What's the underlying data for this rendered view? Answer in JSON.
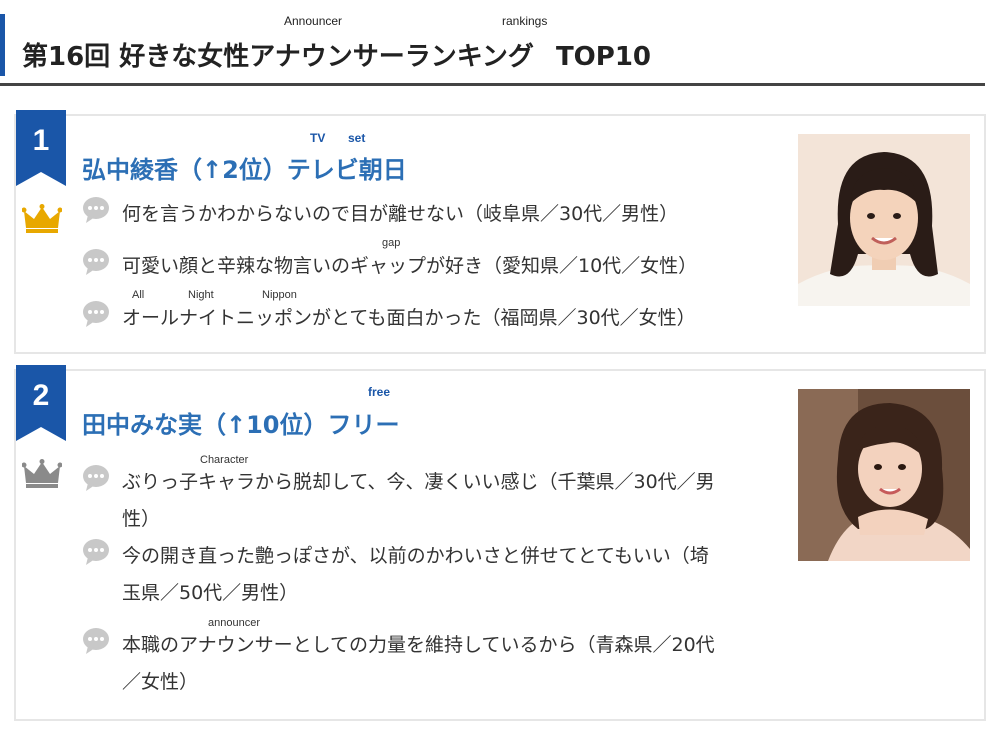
{
  "header": {
    "title_main": "第16回 好きな女性アナウンサーランキング",
    "title_suffix": "TOP10",
    "ruby_announcer": "Announcer",
    "ruby_rankings": "rankings"
  },
  "colors": {
    "accent": "#1a56a8",
    "name_blue": "#2c6fb5",
    "gold": "#e8a800",
    "silver": "#8a8a8a",
    "bubble_gray": "#c8c8c8"
  },
  "entries": [
    {
      "rank": "1",
      "crown": "gold-crown-icon",
      "name": "弘中綾香（↑2位）テレビ朝日",
      "ruby_tv": "TV",
      "ruby_set": "set",
      "comments": [
        "何を言うかわからないので目が離せない（岐阜県／30代／男性）",
        "可愛い顔と辛辣な物言いのギャップが好き（愛知県／10代／女性）",
        "オールナイトニッポンがとても面白かった（福岡県／30代／女性）"
      ],
      "ruby_gap": "gap",
      "ruby_all": "All",
      "ruby_night": "Night",
      "ruby_nippon": "Nippon"
    },
    {
      "rank": "2",
      "crown": "silver-crown-icon",
      "name": "田中みな実（↑10位）フリー",
      "ruby_free": "free",
      "comments": [
        "ぶりっ子キャラから脱却して、今、凄くいい感じ（千葉県／30代／男性）",
        "今の開き直った艶っぽさが、以前のかわいさと併せてとてもいい（埼玉県／50代／男性）",
        "本職のアナウンサーとしての力量を維持しているから（青森県／20代／女性）"
      ],
      "ruby_character": "Character",
      "ruby_announcer": "announcer"
    }
  ]
}
